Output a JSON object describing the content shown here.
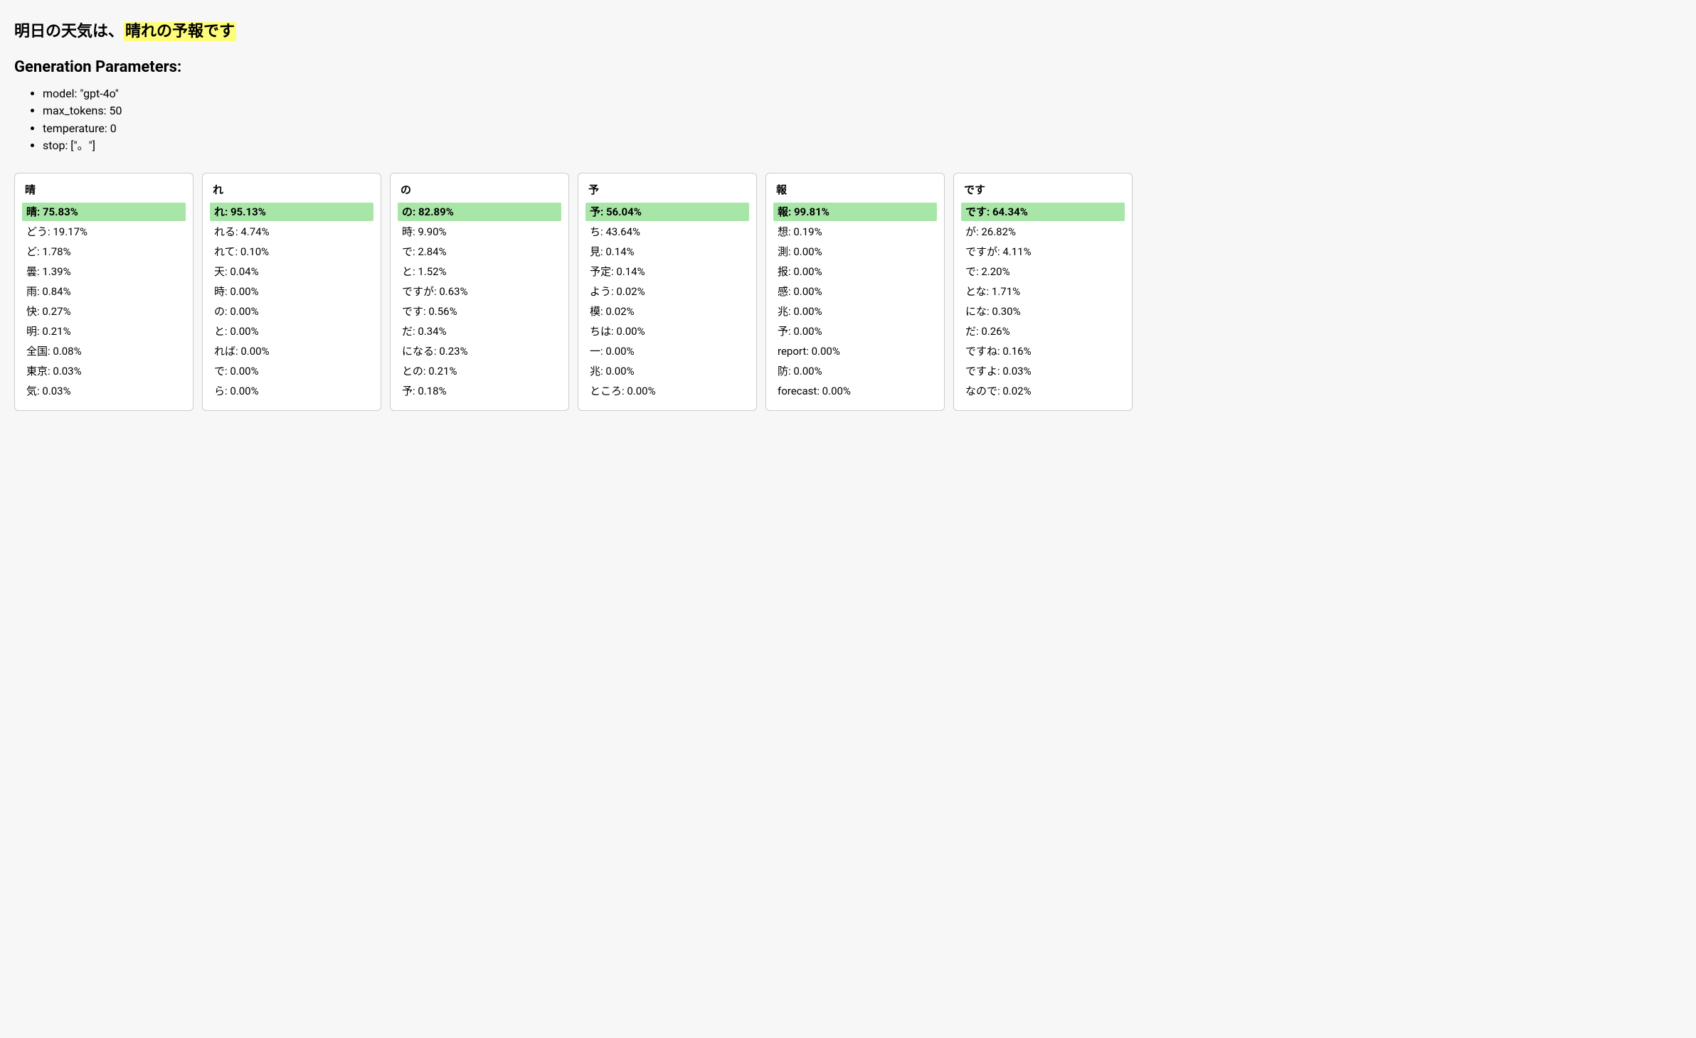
{
  "title_prefix": "明日の天気は、",
  "title_highlight": "晴れの予報です",
  "params_heading": "Generation Parameters:",
  "params": [
    "model: \"gpt-4o\"",
    "max_tokens: 50",
    "temperature: 0",
    "stop: [\"。\"]"
  ],
  "tokens": [
    {
      "token": "晴",
      "candidates": [
        {
          "label": "晴",
          "pct": "75.83%",
          "selected": true
        },
        {
          "label": "どう",
          "pct": "19.17%"
        },
        {
          "label": "ど",
          "pct": "1.78%"
        },
        {
          "label": "曇",
          "pct": "1.39%"
        },
        {
          "label": "雨",
          "pct": "0.84%"
        },
        {
          "label": "快",
          "pct": "0.27%"
        },
        {
          "label": "明",
          "pct": "0.21%"
        },
        {
          "label": "全国",
          "pct": "0.08%"
        },
        {
          "label": "東京",
          "pct": "0.03%"
        },
        {
          "label": "気",
          "pct": "0.03%"
        }
      ]
    },
    {
      "token": "れ",
      "candidates": [
        {
          "label": "れ",
          "pct": "95.13%",
          "selected": true
        },
        {
          "label": "れる",
          "pct": "4.74%"
        },
        {
          "label": "れて",
          "pct": "0.10%"
        },
        {
          "label": "天",
          "pct": "0.04%"
        },
        {
          "label": "時",
          "pct": "0.00%"
        },
        {
          "label": "の",
          "pct": "0.00%"
        },
        {
          "label": "と",
          "pct": "0.00%"
        },
        {
          "label": "れば",
          "pct": "0.00%"
        },
        {
          "label": "で",
          "pct": "0.00%"
        },
        {
          "label": "ら",
          "pct": "0.00%"
        }
      ]
    },
    {
      "token": "の",
      "candidates": [
        {
          "label": "の",
          "pct": "82.89%",
          "selected": true
        },
        {
          "label": "時",
          "pct": "9.90%"
        },
        {
          "label": "で",
          "pct": "2.84%"
        },
        {
          "label": "と",
          "pct": "1.52%"
        },
        {
          "label": "ですが",
          "pct": "0.63%"
        },
        {
          "label": "です",
          "pct": "0.56%"
        },
        {
          "label": "だ",
          "pct": "0.34%"
        },
        {
          "label": "になる",
          "pct": "0.23%"
        },
        {
          "label": "との",
          "pct": "0.21%"
        },
        {
          "label": "予",
          "pct": "0.18%"
        }
      ]
    },
    {
      "token": "予",
      "candidates": [
        {
          "label": "予",
          "pct": "56.04%",
          "selected": true
        },
        {
          "label": "ち",
          "pct": "43.64%"
        },
        {
          "label": "見",
          "pct": "0.14%"
        },
        {
          "label": "予定",
          "pct": "0.14%"
        },
        {
          "label": "よう",
          "pct": "0.02%"
        },
        {
          "label": "模",
          "pct": "0.02%"
        },
        {
          "label": "ちは",
          "pct": "0.00%"
        },
        {
          "label": "一",
          "pct": "0.00%"
        },
        {
          "label": "兆",
          "pct": "0.00%"
        },
        {
          "label": "ところ",
          "pct": "0.00%"
        }
      ]
    },
    {
      "token": "報",
      "candidates": [
        {
          "label": "報",
          "pct": "99.81%",
          "selected": true
        },
        {
          "label": "想",
          "pct": "0.19%"
        },
        {
          "label": "測",
          "pct": "0.00%"
        },
        {
          "label": "报",
          "pct": "0.00%"
        },
        {
          "label": "感",
          "pct": "0.00%"
        },
        {
          "label": "兆",
          "pct": "0.00%"
        },
        {
          "label": "予",
          "pct": "0.00%"
        },
        {
          "label": "report",
          "pct": "0.00%"
        },
        {
          "label": "防",
          "pct": "0.00%"
        },
        {
          "label": "forecast",
          "pct": "0.00%"
        }
      ]
    },
    {
      "token": "です",
      "candidates": [
        {
          "label": "です",
          "pct": "64.34%",
          "selected": true
        },
        {
          "label": "が",
          "pct": "26.82%"
        },
        {
          "label": "ですが",
          "pct": "4.11%"
        },
        {
          "label": "で",
          "pct": "2.20%"
        },
        {
          "label": "とな",
          "pct": "1.71%"
        },
        {
          "label": "にな",
          "pct": "0.30%"
        },
        {
          "label": "だ",
          "pct": "0.26%"
        },
        {
          "label": "ですね",
          "pct": "0.16%"
        },
        {
          "label": "ですよ",
          "pct": "0.03%"
        },
        {
          "label": "なので",
          "pct": "0.02%"
        }
      ]
    }
  ]
}
